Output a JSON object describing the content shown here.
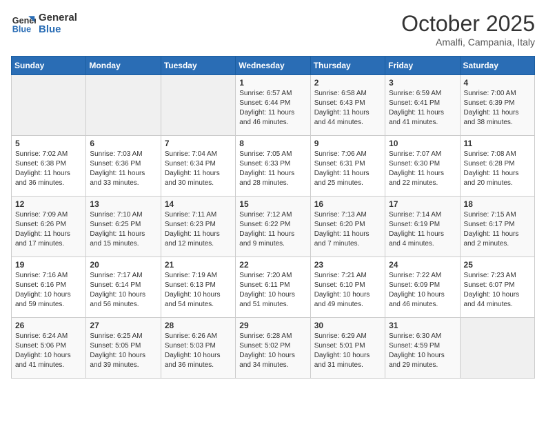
{
  "logo": {
    "line1": "General",
    "line2": "Blue"
  },
  "title": "October 2025",
  "subtitle": "Amalfi, Campania, Italy",
  "days_header": [
    "Sunday",
    "Monday",
    "Tuesday",
    "Wednesday",
    "Thursday",
    "Friday",
    "Saturday"
  ],
  "weeks": [
    [
      {
        "day": "",
        "info": ""
      },
      {
        "day": "",
        "info": ""
      },
      {
        "day": "",
        "info": ""
      },
      {
        "day": "1",
        "info": "Sunrise: 6:57 AM\nSunset: 6:44 PM\nDaylight: 11 hours\nand 46 minutes."
      },
      {
        "day": "2",
        "info": "Sunrise: 6:58 AM\nSunset: 6:43 PM\nDaylight: 11 hours\nand 44 minutes."
      },
      {
        "day": "3",
        "info": "Sunrise: 6:59 AM\nSunset: 6:41 PM\nDaylight: 11 hours\nand 41 minutes."
      },
      {
        "day": "4",
        "info": "Sunrise: 7:00 AM\nSunset: 6:39 PM\nDaylight: 11 hours\nand 38 minutes."
      }
    ],
    [
      {
        "day": "5",
        "info": "Sunrise: 7:02 AM\nSunset: 6:38 PM\nDaylight: 11 hours\nand 36 minutes."
      },
      {
        "day": "6",
        "info": "Sunrise: 7:03 AM\nSunset: 6:36 PM\nDaylight: 11 hours\nand 33 minutes."
      },
      {
        "day": "7",
        "info": "Sunrise: 7:04 AM\nSunset: 6:34 PM\nDaylight: 11 hours\nand 30 minutes."
      },
      {
        "day": "8",
        "info": "Sunrise: 7:05 AM\nSunset: 6:33 PM\nDaylight: 11 hours\nand 28 minutes."
      },
      {
        "day": "9",
        "info": "Sunrise: 7:06 AM\nSunset: 6:31 PM\nDaylight: 11 hours\nand 25 minutes."
      },
      {
        "day": "10",
        "info": "Sunrise: 7:07 AM\nSunset: 6:30 PM\nDaylight: 11 hours\nand 22 minutes."
      },
      {
        "day": "11",
        "info": "Sunrise: 7:08 AM\nSunset: 6:28 PM\nDaylight: 11 hours\nand 20 minutes."
      }
    ],
    [
      {
        "day": "12",
        "info": "Sunrise: 7:09 AM\nSunset: 6:26 PM\nDaylight: 11 hours\nand 17 minutes."
      },
      {
        "day": "13",
        "info": "Sunrise: 7:10 AM\nSunset: 6:25 PM\nDaylight: 11 hours\nand 15 minutes."
      },
      {
        "day": "14",
        "info": "Sunrise: 7:11 AM\nSunset: 6:23 PM\nDaylight: 11 hours\nand 12 minutes."
      },
      {
        "day": "15",
        "info": "Sunrise: 7:12 AM\nSunset: 6:22 PM\nDaylight: 11 hours\nand 9 minutes."
      },
      {
        "day": "16",
        "info": "Sunrise: 7:13 AM\nSunset: 6:20 PM\nDaylight: 11 hours\nand 7 minutes."
      },
      {
        "day": "17",
        "info": "Sunrise: 7:14 AM\nSunset: 6:19 PM\nDaylight: 11 hours\nand 4 minutes."
      },
      {
        "day": "18",
        "info": "Sunrise: 7:15 AM\nSunset: 6:17 PM\nDaylight: 11 hours\nand 2 minutes."
      }
    ],
    [
      {
        "day": "19",
        "info": "Sunrise: 7:16 AM\nSunset: 6:16 PM\nDaylight: 10 hours\nand 59 minutes."
      },
      {
        "day": "20",
        "info": "Sunrise: 7:17 AM\nSunset: 6:14 PM\nDaylight: 10 hours\nand 56 minutes."
      },
      {
        "day": "21",
        "info": "Sunrise: 7:19 AM\nSunset: 6:13 PM\nDaylight: 10 hours\nand 54 minutes."
      },
      {
        "day": "22",
        "info": "Sunrise: 7:20 AM\nSunset: 6:11 PM\nDaylight: 10 hours\nand 51 minutes."
      },
      {
        "day": "23",
        "info": "Sunrise: 7:21 AM\nSunset: 6:10 PM\nDaylight: 10 hours\nand 49 minutes."
      },
      {
        "day": "24",
        "info": "Sunrise: 7:22 AM\nSunset: 6:09 PM\nDaylight: 10 hours\nand 46 minutes."
      },
      {
        "day": "25",
        "info": "Sunrise: 7:23 AM\nSunset: 6:07 PM\nDaylight: 10 hours\nand 44 minutes."
      }
    ],
    [
      {
        "day": "26",
        "info": "Sunrise: 6:24 AM\nSunset: 5:06 PM\nDaylight: 10 hours\nand 41 minutes."
      },
      {
        "day": "27",
        "info": "Sunrise: 6:25 AM\nSunset: 5:05 PM\nDaylight: 10 hours\nand 39 minutes."
      },
      {
        "day": "28",
        "info": "Sunrise: 6:26 AM\nSunset: 5:03 PM\nDaylight: 10 hours\nand 36 minutes."
      },
      {
        "day": "29",
        "info": "Sunrise: 6:28 AM\nSunset: 5:02 PM\nDaylight: 10 hours\nand 34 minutes."
      },
      {
        "day": "30",
        "info": "Sunrise: 6:29 AM\nSunset: 5:01 PM\nDaylight: 10 hours\nand 31 minutes."
      },
      {
        "day": "31",
        "info": "Sunrise: 6:30 AM\nSunset: 4:59 PM\nDaylight: 10 hours\nand 29 minutes."
      },
      {
        "day": "",
        "info": ""
      }
    ]
  ]
}
